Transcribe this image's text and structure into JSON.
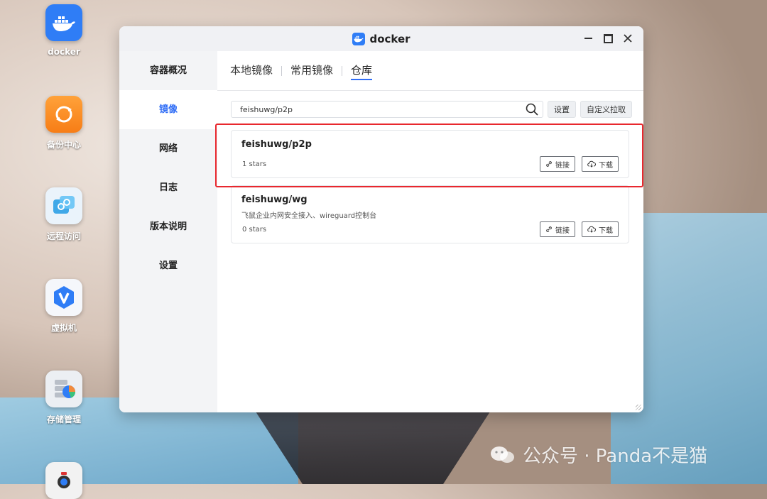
{
  "desktop": {
    "icons": [
      {
        "label": "docker"
      },
      {
        "label": "备份中心"
      },
      {
        "label": "远程访问"
      },
      {
        "label": "虚拟机"
      },
      {
        "label": "存储管理"
      }
    ]
  },
  "window": {
    "title": "docker",
    "sidebar": {
      "items": [
        {
          "label": "容器概况"
        },
        {
          "label": "镜像"
        },
        {
          "label": "网络"
        },
        {
          "label": "日志"
        },
        {
          "label": "版本说明"
        },
        {
          "label": "设置"
        }
      ],
      "active": "镜像"
    },
    "tabs": [
      {
        "label": "本地镜像"
      },
      {
        "label": "常用镜像"
      },
      {
        "label": "仓库"
      }
    ],
    "active_tab": "仓库",
    "search": {
      "value": "feishuwg/p2p"
    },
    "buttons": {
      "settings": "设置",
      "custom_pull": "自定义拉取"
    },
    "results": [
      {
        "name": "feishuwg/p2p",
        "description": "",
        "stars": "1 stars",
        "link_label": "链接",
        "download_label": "下载"
      },
      {
        "name": "feishuwg/wg",
        "description": "飞鼠企业内网安全接入、wireguard控制台",
        "stars": "0 stars",
        "link_label": "链接",
        "download_label": "下载"
      }
    ]
  },
  "watermark": {
    "text": "公众号 · Panda不是猫"
  },
  "colors": {
    "accent": "#2f6df6",
    "highlight": "#e8282e",
    "docker_blue": "#2f7df6"
  }
}
